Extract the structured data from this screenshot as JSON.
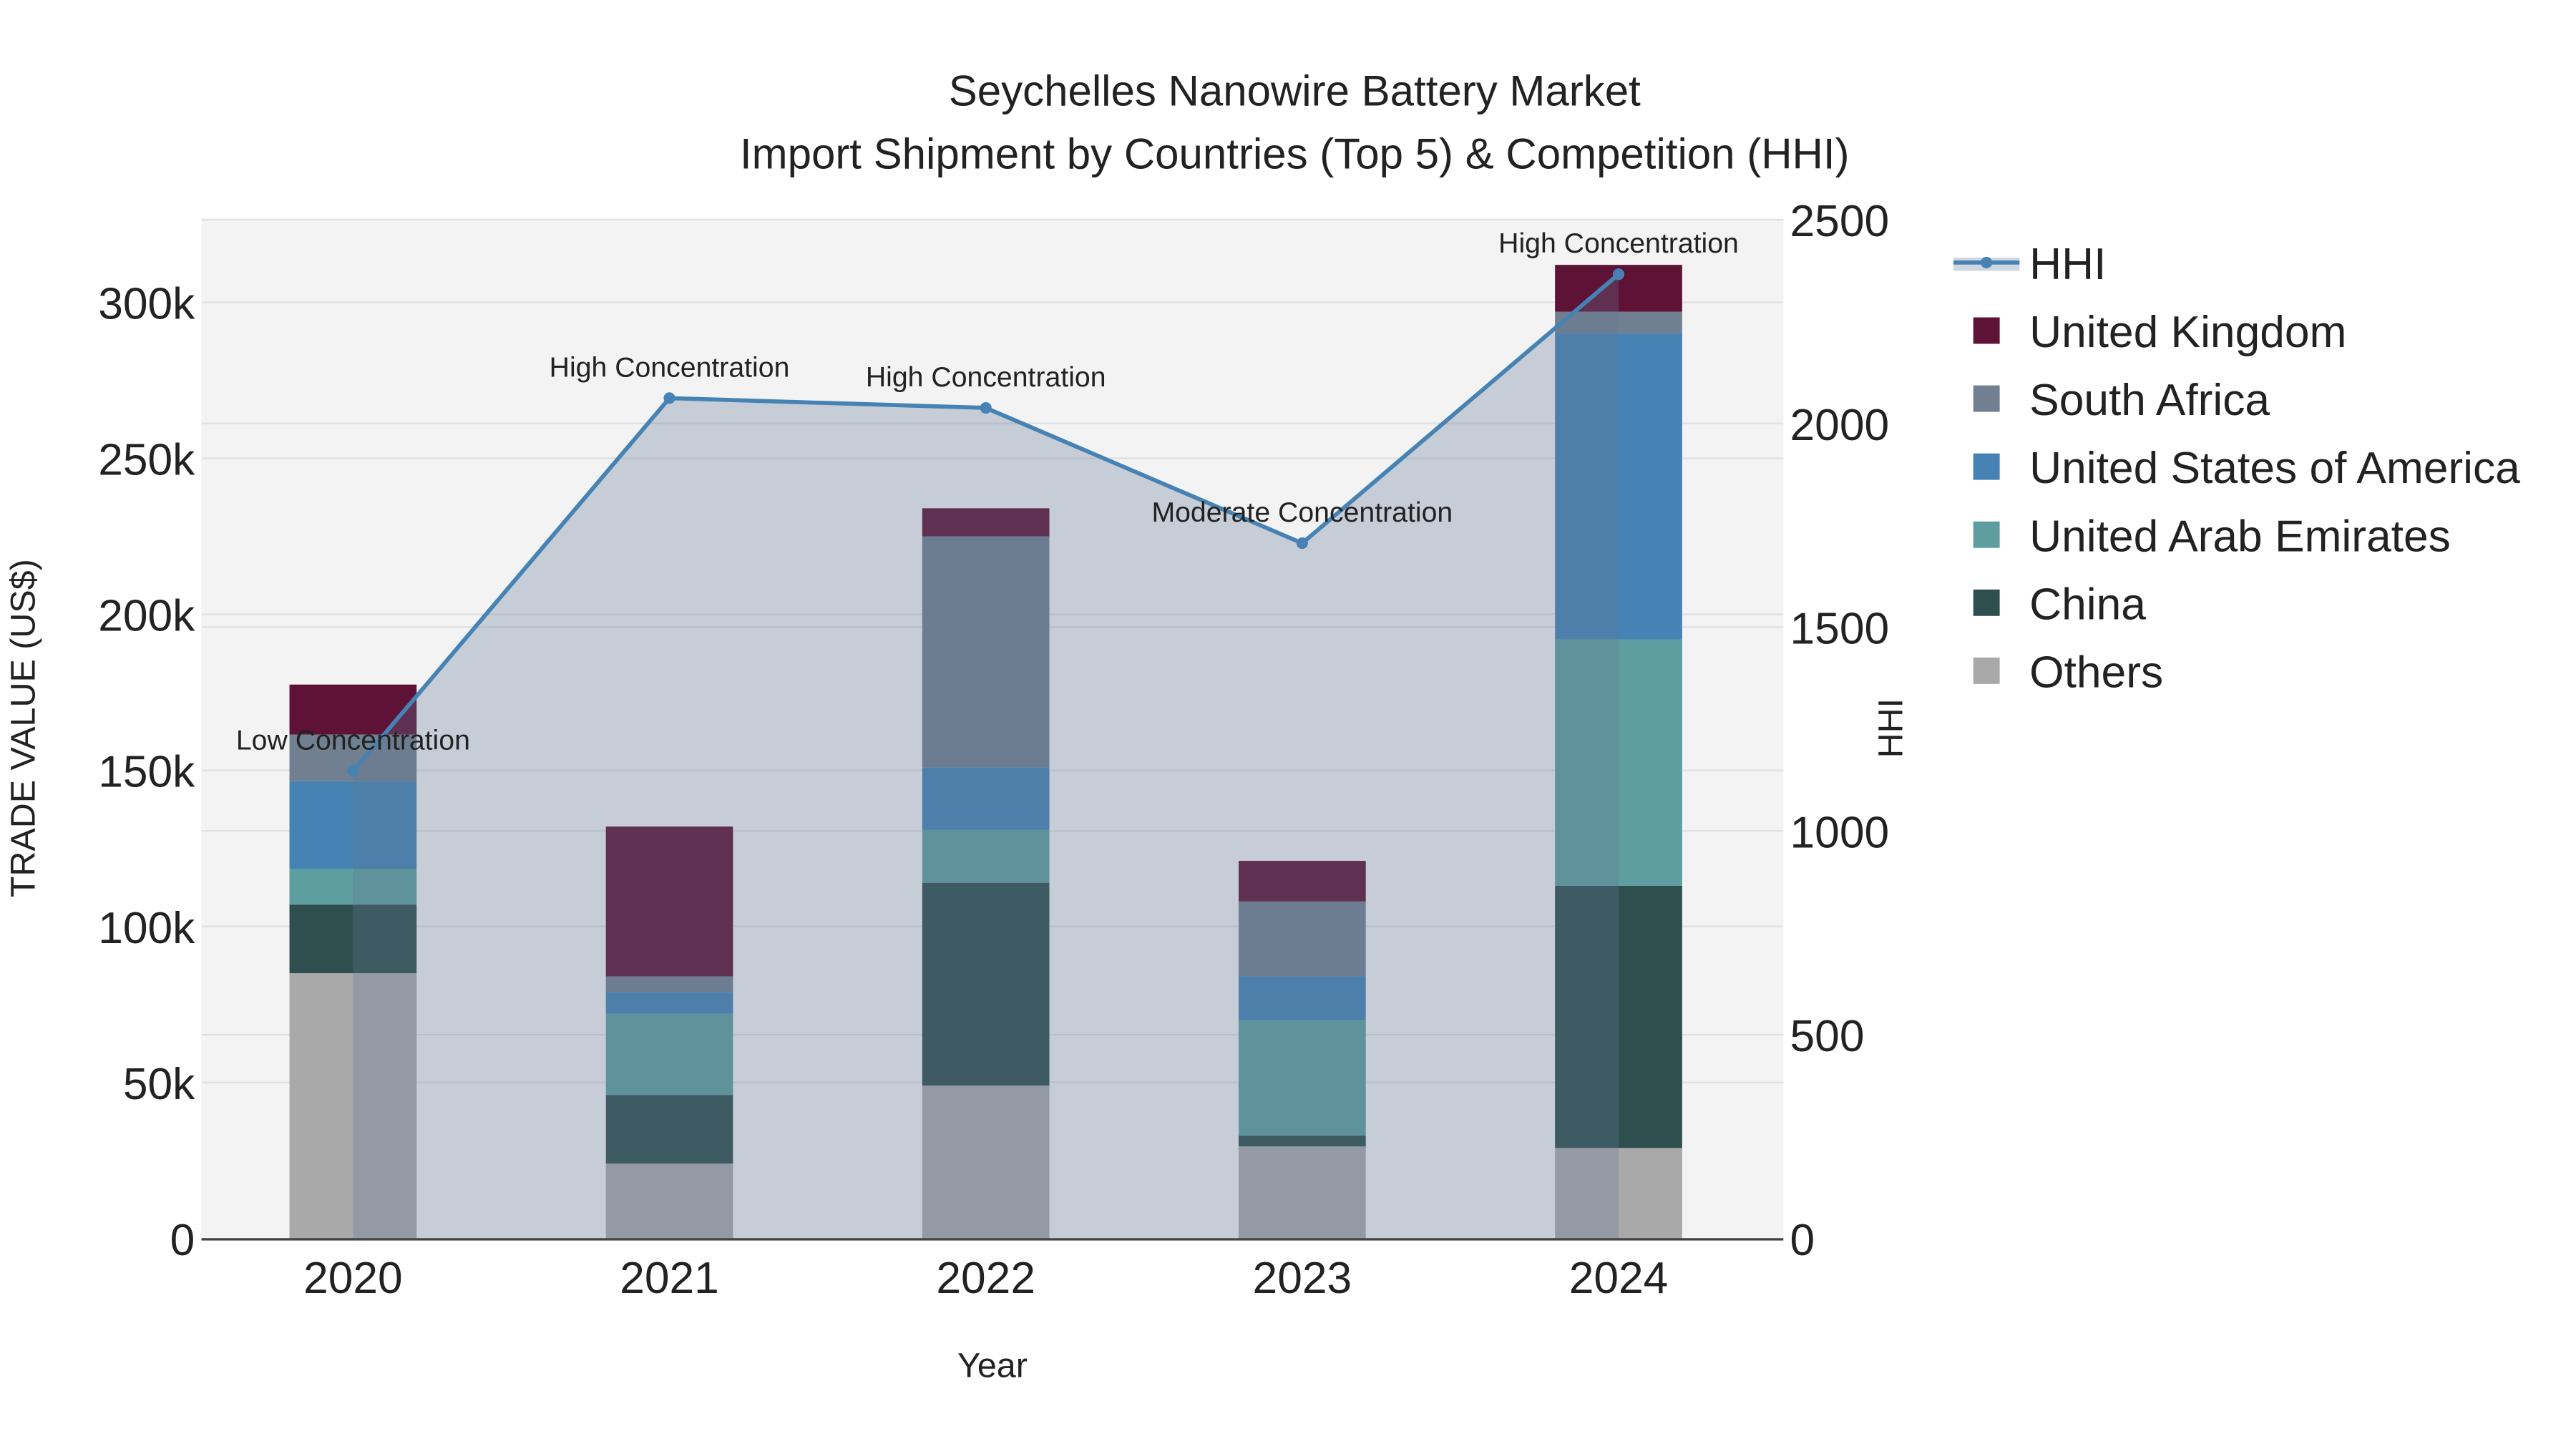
{
  "chart_data": {
    "type": "bar",
    "title": "Seychelles Nanowire Battery Market",
    "subtitle": "Import Shipment by Countries (Top 5) & Competition (HHI)",
    "xlabel": "Year",
    "ylabel": "TRADE VALUE (US$)",
    "y2label": "HHI",
    "categories": [
      "2020",
      "2021",
      "2022",
      "2023",
      "2024"
    ],
    "ylim": [
      0,
      326500
    ],
    "y2lim": [
      0,
      2500
    ],
    "yticks": [
      0,
      50000,
      100000,
      150000,
      200000,
      250000,
      300000
    ],
    "ytick_labels": [
      "0",
      "50k",
      "100k",
      "150k",
      "200k",
      "250k",
      "300k"
    ],
    "y2ticks": [
      0,
      500,
      1000,
      1500,
      2000,
      2500
    ],
    "y2tick_labels": [
      "0",
      "500",
      "1000",
      "1500",
      "2000",
      "2500"
    ],
    "grid": true,
    "legend_position": "right",
    "series": [
      {
        "name": "Others",
        "color": "#a9a9a9",
        "values": [
          85000,
          24000,
          49000,
          29500,
          29000
        ]
      },
      {
        "name": "China",
        "color": "#2f4f4f",
        "values": [
          22000,
          22000,
          65000,
          3500,
          84000
        ]
      },
      {
        "name": "United Arab Emirates",
        "color": "#5f9ea0",
        "values": [
          11500,
          26000,
          17000,
          37000,
          79000
        ]
      },
      {
        "name": "United States of America",
        "color": "#4682b4",
        "values": [
          28000,
          7000,
          20000,
          14000,
          98000
        ]
      },
      {
        "name": "South Africa",
        "color": "#708090",
        "values": [
          15000,
          5000,
          74000,
          24000,
          7000
        ]
      },
      {
        "name": "United Kingdom",
        "color": "#5e1235",
        "values": [
          16000,
          48000,
          9000,
          13000,
          15000
        ]
      }
    ],
    "hhi": {
      "name": "HHI",
      "color": "#4682b4",
      "values": [
        1147,
        2062,
        2038,
        1706,
        2366
      ],
      "annotations": [
        "Low Concentration",
        "High Concentration",
        "High Concentration",
        "Moderate Concentration",
        "High Concentration"
      ]
    },
    "legend_order": [
      "HHI",
      "United Kingdom",
      "South Africa",
      "United States of America",
      "United Arab Emirates",
      "China",
      "Others"
    ]
  }
}
